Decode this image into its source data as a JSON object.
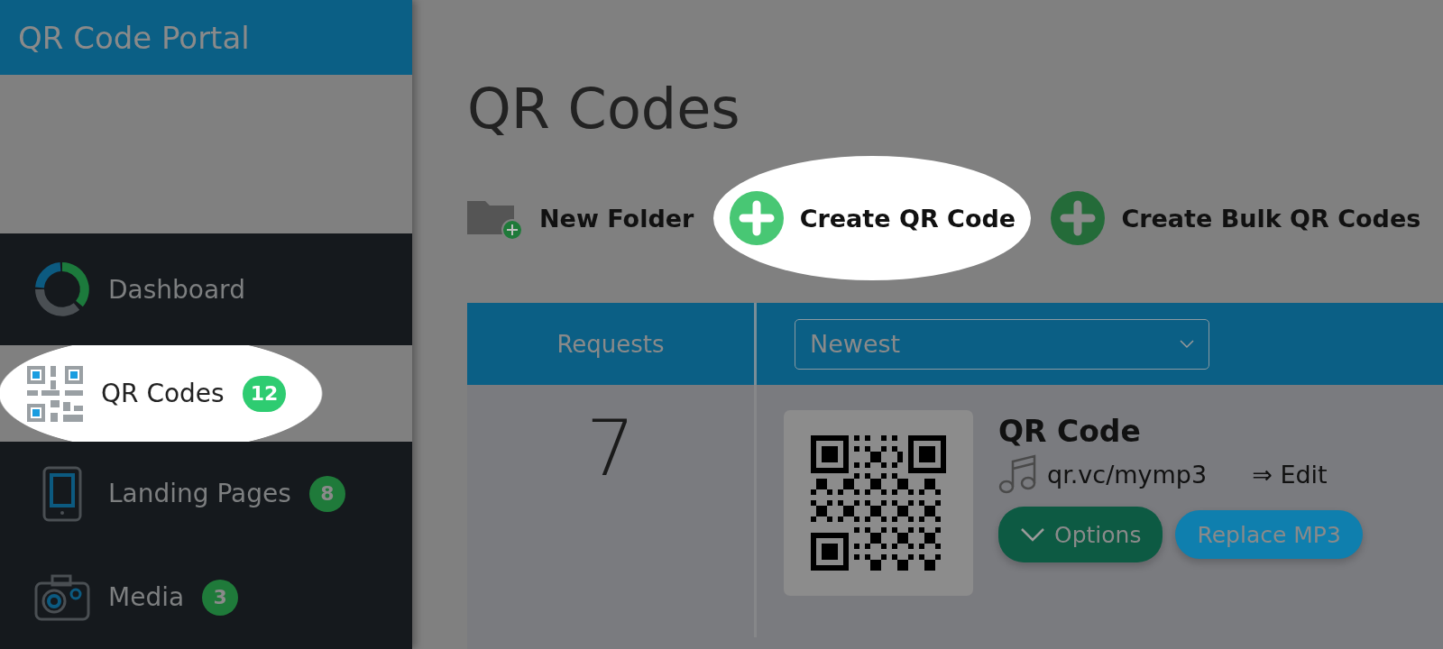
{
  "app": {
    "title": "QR Code Portal"
  },
  "sidebar": {
    "items": [
      {
        "label": "Dashboard",
        "selected": false,
        "spotlight": false
      },
      {
        "label": "QR Codes",
        "badge": "12",
        "selected": true,
        "spotlight": true
      },
      {
        "label": "Landing Pages",
        "badge": "8",
        "selected": false,
        "spotlight": false
      },
      {
        "label": "Media",
        "badge": "3",
        "selected": false,
        "spotlight": false
      }
    ]
  },
  "page": {
    "title": "QR Codes"
  },
  "toolbar": [
    {
      "label": "New Folder",
      "spotlight": false
    },
    {
      "label": "Create QR Code",
      "spotlight": true
    },
    {
      "label": "Create Bulk QR Codes",
      "spotlight": false
    }
  ],
  "table": {
    "columns": [
      {
        "label": "Requests"
      }
    ],
    "sort": {
      "value": "Newest"
    },
    "rows": [
      {
        "requests": "7",
        "name": "QR Code",
        "url": "qr.vc/mymp3",
        "edit": "⇒ Edit",
        "options": "Options",
        "action": "Replace MP3"
      }
    ]
  }
}
